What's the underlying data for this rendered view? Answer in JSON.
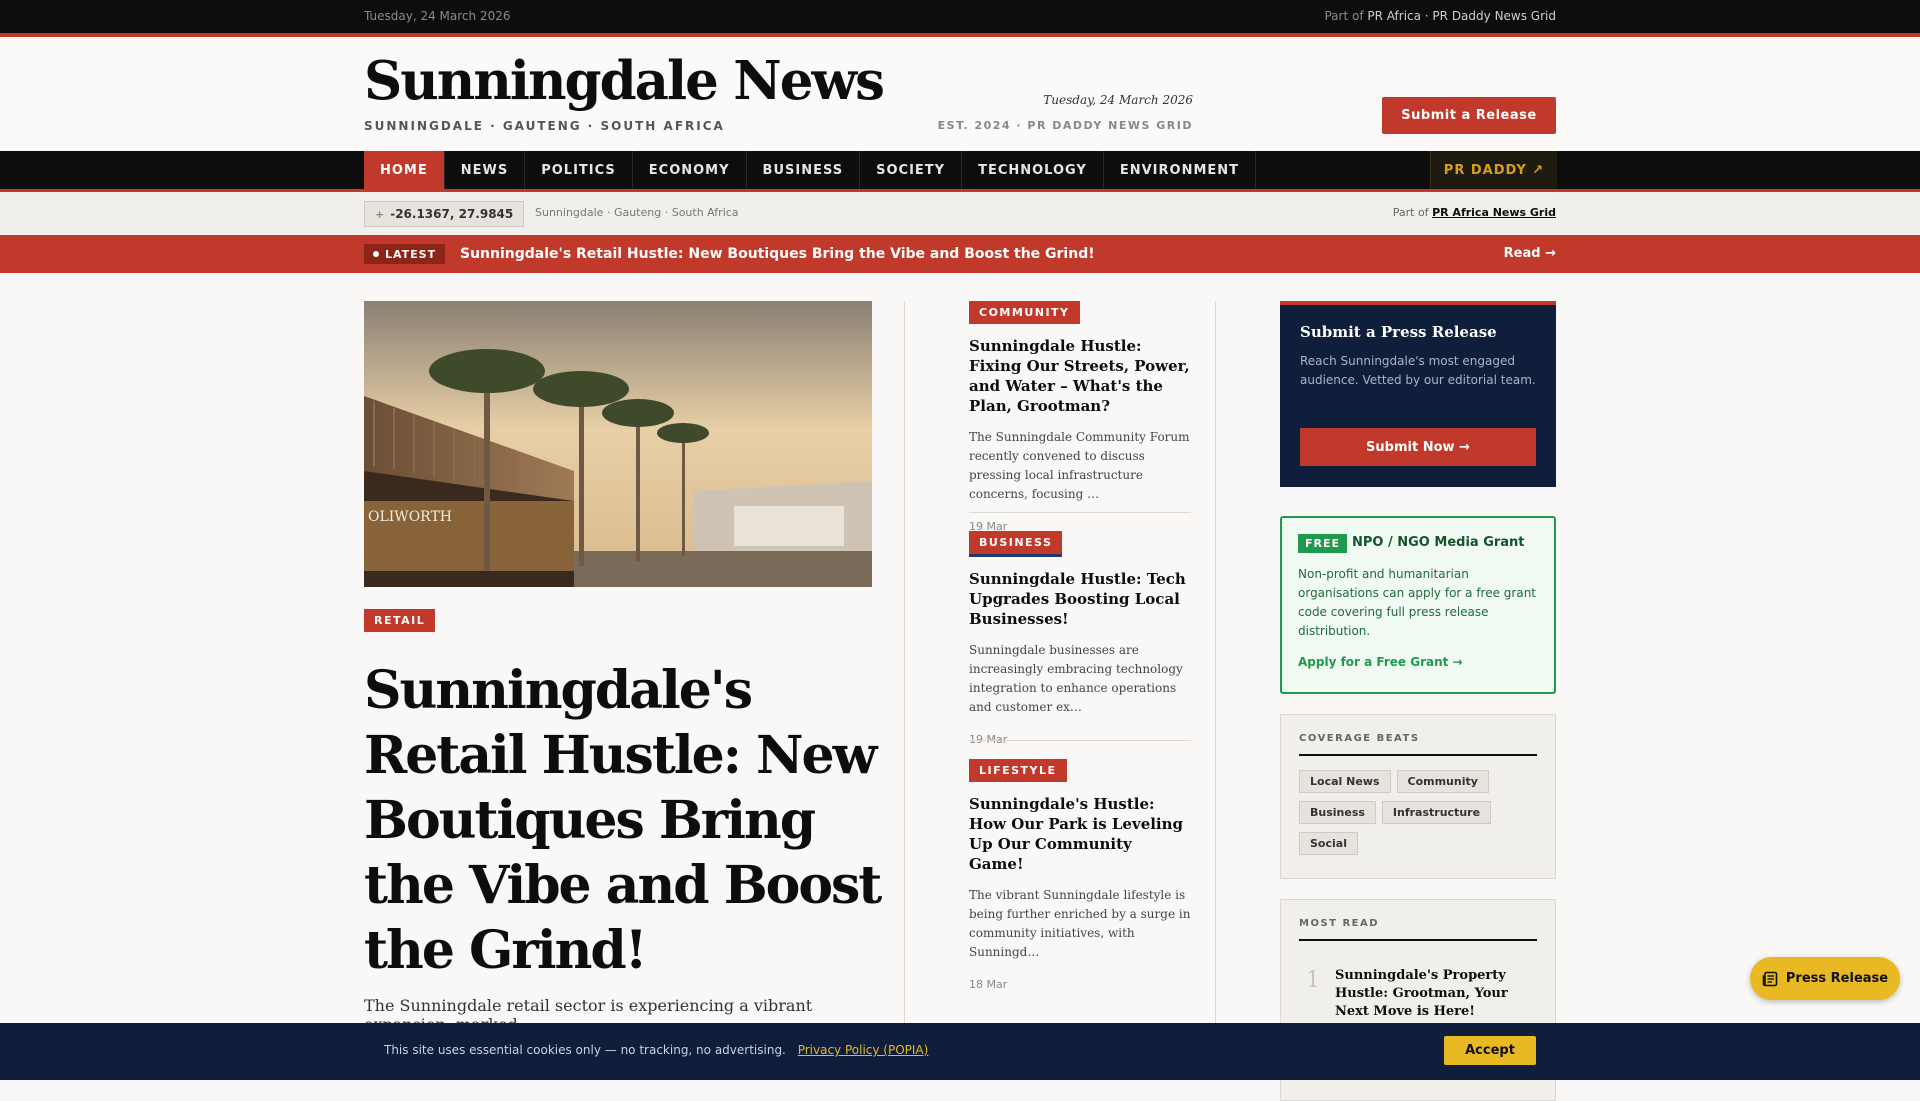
{
  "topbar": {
    "date": "Tuesday, 24 March 2026",
    "part_prefix": "Part of",
    "part_links": "PR Africa · PR Daddy News Grid"
  },
  "masthead": {
    "logo": "Sunningdale News",
    "tagline": "SUNNINGDALE · GAUTENG · SOUTH AFRICA",
    "date": "Tuesday, 24 March 2026",
    "est": "EST. 2024 · PR DADDY NEWS GRID",
    "submit_label": "Submit a Release"
  },
  "nav": {
    "items": [
      {
        "label": "HOME"
      },
      {
        "label": "NEWS"
      },
      {
        "label": "POLITICS"
      },
      {
        "label": "ECONOMY"
      },
      {
        "label": "BUSINESS"
      },
      {
        "label": "SOCIETY"
      },
      {
        "label": "TECHNOLOGY"
      },
      {
        "label": "ENVIRONMENT"
      }
    ],
    "active": "HOME",
    "pr_label": "PR DADDY ↗"
  },
  "location": {
    "coords": "-26.1367, 27.9845",
    "name": "Sunningdale · Gauteng · South Africa",
    "part_prefix": "Part of",
    "part_link": "PR Africa News Grid"
  },
  "ticker": {
    "badge": "LATEST",
    "headline": "Sunningdale's Retail Hustle: New Boutiques Bring the Vibe and Boost the Grind!",
    "read_label": "Read →"
  },
  "hero": {
    "image_sign": "OLIWORTH",
    "category": "RETAIL",
    "title": "Sunningdale's Retail Hustle: New Boutiques Bring the Vibe and Boost the Grind!",
    "summary": "The Sunningdale retail sector is experiencing a vibrant expansion, marked"
  },
  "stories": [
    {
      "category": "COMMUNITY",
      "title": "Sunningdale Hustle: Fixing Our Streets, Power, and Water – What's the Plan, Grootman?",
      "excerpt": "The Sunningdale Community Forum recently convened to discuss pressing local infrastructure concerns, focusing …",
      "date": "19 Mar"
    },
    {
      "category": "BUSINESS",
      "title": "Sunningdale Hustle: Tech Upgrades Boosting Local Businesses!",
      "excerpt": "Sunningdale businesses are increasingly embracing technology integration to enhance operations and customer ex…",
      "date": "19 Mar"
    },
    {
      "category": "LIFESTYLE",
      "title": "Sunningdale's Hustle: How Our Park is Leveling Up Our Community Game!",
      "excerpt": "The vibrant Sunningdale lifestyle is being further enriched by a surge in community initiatives, with Sunningd…",
      "date": "18 Mar"
    }
  ],
  "press_box": {
    "title": "Submit a Press Release",
    "text": "Reach Sunningdale's most engaged audience. Vetted by our editorial team.",
    "button": "Submit Now →"
  },
  "grant": {
    "badge": "FREE",
    "title": "NPO / NGO Media Grant",
    "text": "Non-profit and humanitarian organisations can apply for a free grant code covering full press release distribution.",
    "link": "Apply for a Free Grant →"
  },
  "beats": {
    "heading": "COVERAGE BEATS",
    "items": [
      "Local News",
      "Community",
      "Business",
      "Infrastructure",
      "Social"
    ]
  },
  "most_read": {
    "heading": "MOST READ",
    "items": [
      {
        "rank": "1",
        "title": "Sunningdale's Property Hustle: Grootman, Your Next Move is Here!"
      }
    ]
  },
  "cookie": {
    "text": "This site uses essential cookies only — no tracking, no advertising.",
    "policy": "Privacy Policy (POPIA)",
    "accept": "Accept"
  },
  "fab": {
    "label": "Press Release"
  },
  "colors": {
    "accent": "#c0392b",
    "navy": "#0f1e3b",
    "gold": "#e8b923",
    "green": "#1f9a4d"
  }
}
